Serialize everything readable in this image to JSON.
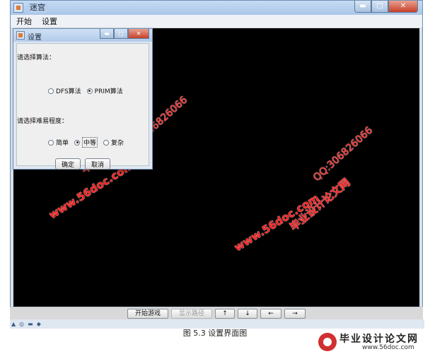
{
  "window": {
    "title": "迷宫",
    "min": "▬",
    "max": "□",
    "close": "✕"
  },
  "menu": [
    {
      "label": "开始"
    },
    {
      "label": "设置"
    }
  ],
  "dialog": {
    "title": "设置",
    "min": "▬",
    "max": "□",
    "close": "✕",
    "algorithm_label": "请选择算法：",
    "algorithms": [
      {
        "label": "DFS算法",
        "checked": false
      },
      {
        "label": "PRIM算法",
        "checked": true
      }
    ],
    "difficulty_label": "请选择难易程度：",
    "difficulties": [
      {
        "label": "简单",
        "checked": false
      },
      {
        "label": "中等",
        "checked": true
      },
      {
        "label": "复杂",
        "checked": false
      }
    ],
    "ok_label": "确定",
    "cancel_label": "取消"
  },
  "controls": {
    "start_game": "开始游戏",
    "show_path": "显示路径",
    "up": "↑",
    "down": "↓",
    "left": "←",
    "right": "→"
  },
  "watermark": {
    "title": "毕业设计论文网",
    "url": "www.56doc.com",
    "qq": "QQ:306826066"
  },
  "caption": "图 5.3 设置界面图",
  "logo": {
    "title": "毕业设计论文网",
    "url": "www.56doc.com"
  },
  "colors": {
    "canvas": "#000000",
    "watermark": "#ff1e1e",
    "titlebar": "#b7cfec"
  }
}
